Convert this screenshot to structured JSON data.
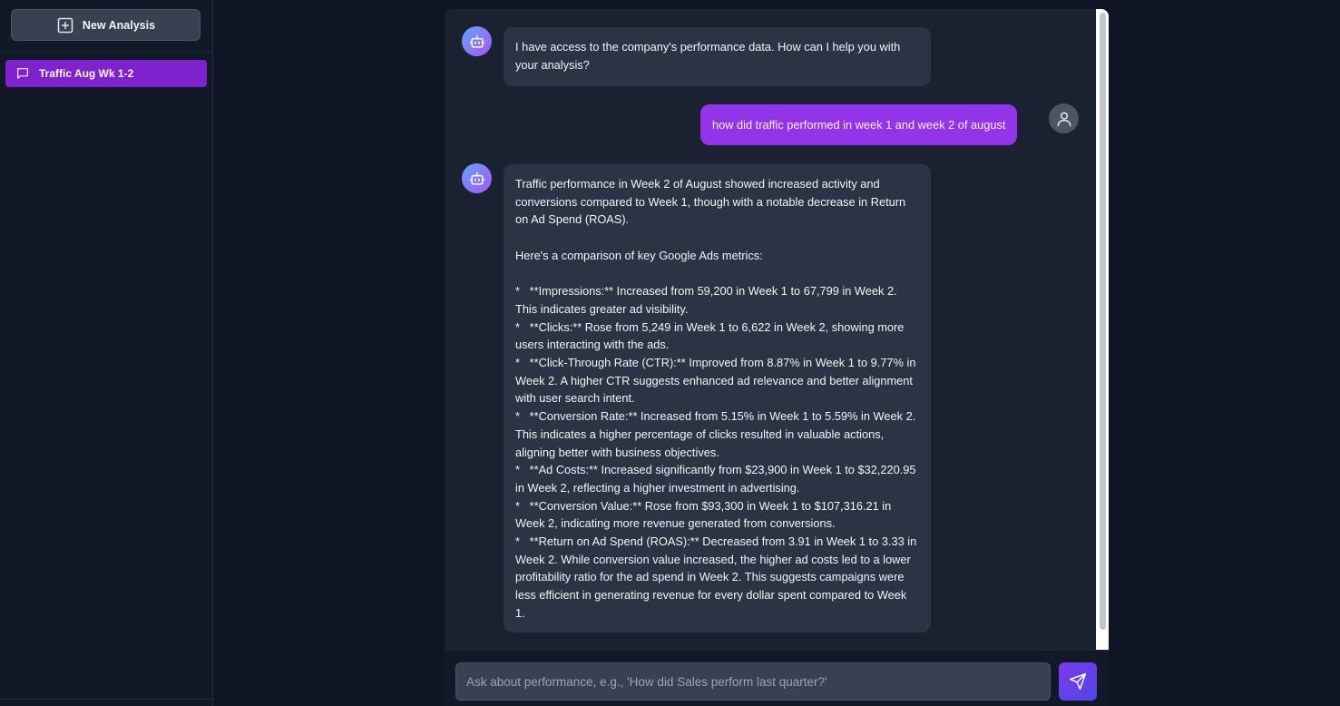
{
  "sidebar": {
    "new_analysis_label": "New Analysis",
    "items": [
      {
        "label": "Traffic Aug Wk 1-2",
        "icon": "chat-bubble-icon",
        "active": true
      }
    ]
  },
  "messages": [
    {
      "role": "assistant",
      "paragraphs": [
        "I have access to the company's performance data. How can I help you with your analysis?"
      ]
    },
    {
      "role": "user",
      "text": "how did traffic performed in week 1 and week 2 of august"
    },
    {
      "role": "assistant",
      "paragraphs": [
        "Traffic performance in Week 2 of August showed increased activity and conversions compared to Week 1, though with a notable decrease in Return on Ad Spend (ROAS).",
        "",
        "Here's a comparison of key Google Ads metrics:",
        "",
        "*   **Impressions:** Increased from 59,200 in Week 1 to 67,799 in Week 2. This indicates greater ad visibility.",
        "*   **Clicks:** Rose from 5,249 in Week 1 to 6,622 in Week 2, showing more users interacting with the ads.",
        "*   **Click-Through Rate (CTR):** Improved from 8.87% in Week 1 to 9.77% in Week 2. A higher CTR suggests enhanced ad relevance and better alignment with user search intent.",
        "*   **Conversion Rate:** Increased from 5.15% in Week 1 to 5.59% in Week 2. This indicates a higher percentage of clicks resulted in valuable actions, aligning better with business objectives.",
        "*   **Ad Costs:** Increased significantly from $23,900 in Week 1 to $32,220.95 in Week 2, reflecting a higher investment in advertising.",
        "*   **Conversion Value:** Rose from $93,300 in Week 1 to $107,316.21 in Week 2, indicating more revenue generated from conversions.",
        "*   **Return on Ad Spend (ROAS):** Decreased from 3.91 in Week 1 to 3.33 in Week 2. While conversion value increased, the higher ad costs led to a lower profitability ratio for the ad spend in Week 2. This suggests campaigns were less efficient in generating revenue for every dollar spent compared to Week 1."
      ]
    }
  ],
  "composer": {
    "placeholder": "Ask about performance, e.g., 'How did Sales perform last quarter?'",
    "value": ""
  },
  "colors": {
    "accent": "#9333ea",
    "active_item": "#7e22ce",
    "background": "#0f1524",
    "bubble_bot": "#2b3444"
  }
}
